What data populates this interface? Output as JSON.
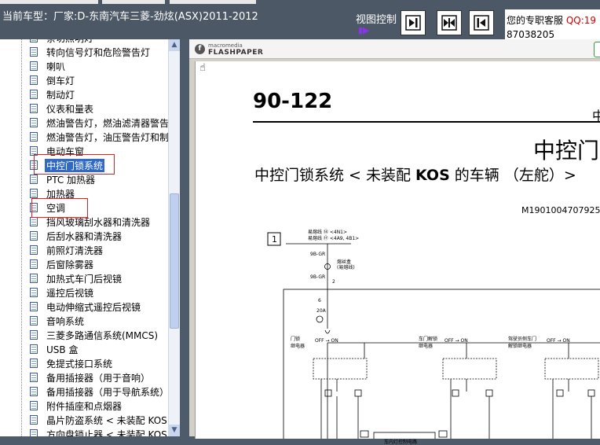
{
  "header": {
    "car_model": "当前车型：厂家:D-东南汽车三菱-劲炫(ASX)2011-2012",
    "view_control_label": "视图控制",
    "view_control_icon": "purple-arrow-icon",
    "view_buttons": [
      "arrow-right-bar-icon",
      "arrows-inward-bar-icon",
      "arrow-left-bar-icon"
    ]
  },
  "service": {
    "label": "您的专职客服",
    "qq_label": "QQ:19",
    "phone": "87038205"
  },
  "tree": {
    "items": [
      {
        "label": "亲切照明灯",
        "selected": false
      },
      {
        "label": "转向信号灯和危险警告灯",
        "selected": false
      },
      {
        "label": "喇叭",
        "selected": false
      },
      {
        "label": "倒车灯",
        "selected": false
      },
      {
        "label": "制动灯",
        "selected": false
      },
      {
        "label": "仪表和量表",
        "selected": false
      },
      {
        "label": "燃油警告灯，燃油滤清器警告",
        "selected": false
      },
      {
        "label": "燃油警告灯，油压警告灯和制",
        "selected": false
      },
      {
        "label": "电动车窗",
        "selected": false
      },
      {
        "label": "中控门锁系统",
        "selected": true
      },
      {
        "label": "PTC 加热器",
        "selected": false
      },
      {
        "label": "加热器",
        "selected": false
      },
      {
        "label": "空调",
        "selected": false
      },
      {
        "label": "挡风玻璃刮水器和清洗器",
        "selected": false
      },
      {
        "label": "后刮水器和清洗器",
        "selected": false
      },
      {
        "label": "前照灯清洗器",
        "selected": false
      },
      {
        "label": "后窗除雾器",
        "selected": false
      },
      {
        "label": "加热式车门后视镜",
        "selected": false
      },
      {
        "label": "遥控后视镜",
        "selected": false
      },
      {
        "label": "电动伸缩式遥控后视镜",
        "selected": false
      },
      {
        "label": "音响系统",
        "selected": false
      },
      {
        "label": "三菱多路通信系统(MMCS)",
        "selected": false
      },
      {
        "label": "USB 盒",
        "selected": false
      },
      {
        "label": "免提式接口系统",
        "selected": false
      },
      {
        "label": "备用插接器（用于音响）",
        "selected": false
      },
      {
        "label": "备用插接器（用于导航系统）",
        "selected": false
      },
      {
        "label": "附件插座和点烟器",
        "selected": false
      },
      {
        "label": "晶片防盗系统  < 未装配  KOS",
        "selected": false
      },
      {
        "label": "方向盘锁止器 < 未装配  KOS",
        "selected": false
      }
    ]
  },
  "viewer": {
    "logo_small": "macromedia",
    "logo_big": "FLASHPAPER",
    "page_number": "90-122",
    "corner_char": "中",
    "big_title": "中控门",
    "section_title_cn1": "中控门锁系统 < 未装配 ",
    "section_title_kos": "KOS",
    "section_title_cn2": " 的车辆 （左舵）>",
    "code": "M1901004707925",
    "diagram": {
      "box_number": "1",
      "fuse_line1": "易熔线",
      "fuse_ref1": "<4N1>",
      "fuse_line2": "易熔线",
      "fuse_ref2": "<4A9, 4B1>",
      "wire_a": "9B-GR",
      "wire_b": "9B-GR",
      "note1": "熔丝盒",
      "note2": "(易熔线)",
      "node_2": "2",
      "fuse_no": "6",
      "fuse_amp": "20A",
      "relay1": "门锁\n继电器",
      "relay2": "车门解锁\n继电器",
      "relay3": "驾驶员侧车门\n解锁继电器",
      "off_on": "OFF → ON",
      "module": "车内灯控制电路"
    }
  }
}
